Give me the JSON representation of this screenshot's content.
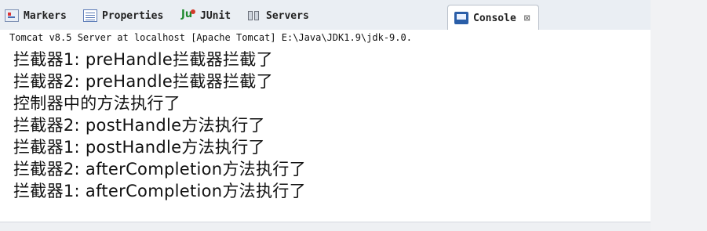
{
  "tabs": [
    {
      "label": "Markers",
      "icon": "markers-icon"
    },
    {
      "label": "Properties",
      "icon": "properties-icon"
    },
    {
      "label": "JUnit",
      "icon": "junit-icon"
    },
    {
      "label": "Servers",
      "icon": "servers-icon"
    },
    {
      "label": "Console",
      "icon": "console-icon",
      "active": true,
      "close": "⊠"
    }
  ],
  "console": {
    "header": "Tomcat v8.5 Server at localhost [Apache Tomcat] E:\\Java\\JDK1.9\\jdk-9.0.",
    "lines": [
      "拦截器1: preHandle拦截器拦截了",
      "拦截器2: preHandle拦截器拦截了",
      "控制器中的方法执行了",
      "拦截器2: postHandle方法执行了",
      "拦截器1: postHandle方法执行了",
      "拦截器2: afterCompletion方法执行了",
      "拦截器1: afterCompletion方法执行了"
    ]
  }
}
